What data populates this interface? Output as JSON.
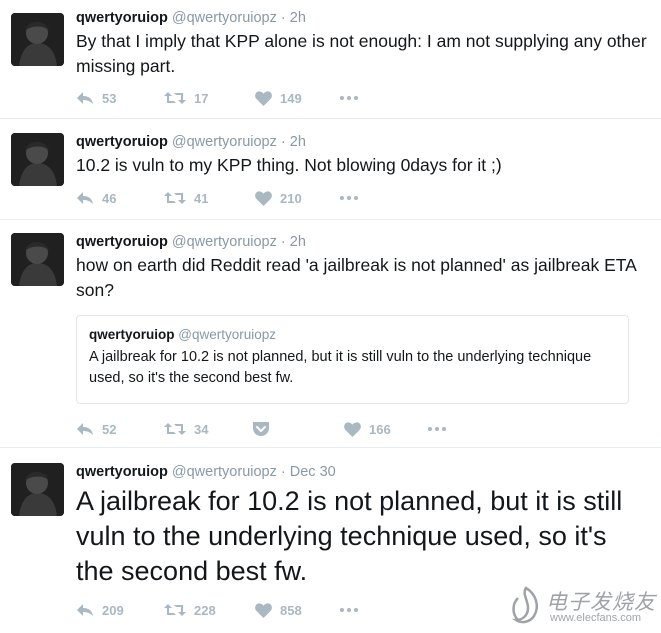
{
  "tweets": [
    {
      "username": "qwertyoruiop",
      "handle": "@qwertyoruiopz",
      "sep": "·",
      "time": "2h",
      "text": "By that I imply that KPP alone is not enough: I am not supplying any other missing part.",
      "replies": "53",
      "retweets": "17",
      "likes": "149"
    },
    {
      "username": "qwertyoruiop",
      "handle": "@qwertyoruiopz",
      "sep": "·",
      "time": "2h",
      "text": "10.2 is vuln to my KPP thing. Not blowing 0days for it ;)",
      "replies": "46",
      "retweets": "41",
      "likes": "210"
    },
    {
      "username": "qwertyoruiop",
      "handle": "@qwertyoruiopz",
      "sep": "·",
      "time": "2h",
      "text": "how on earth did Reddit read 'a jailbreak is not planned' as jailbreak ETA son?",
      "quote": {
        "username": "qwertyoruiop",
        "handle": "@qwertyoruiopz",
        "text": "A jailbreak for 10.2 is not planned, but it is still vuln to the underlying technique used, so it's the second best fw."
      },
      "replies": "52",
      "retweets": "34",
      "likes": "166"
    },
    {
      "username": "qwertyoruiop",
      "handle": "@qwertyoruiopz",
      "sep": "·",
      "time": "Dec 30",
      "text": "A jailbreak for 10.2 is not planned, but it is still vuln to the underlying technique used, so it's the second best fw.",
      "replies": "209",
      "retweets": "228",
      "likes": "858"
    }
  ],
  "icons": {
    "reply": "reply-icon",
    "retweet": "retweet-icon",
    "like": "heart-icon",
    "more": "more-icon",
    "pocket": "pocket-icon"
  },
  "watermark": {
    "cn": "电子发烧友",
    "url": "www.elecfans.com"
  },
  "colors": {
    "text": "#14171a",
    "muted": "#8899a6",
    "icon": "#aab8c2",
    "border": "#e6ecf0"
  }
}
